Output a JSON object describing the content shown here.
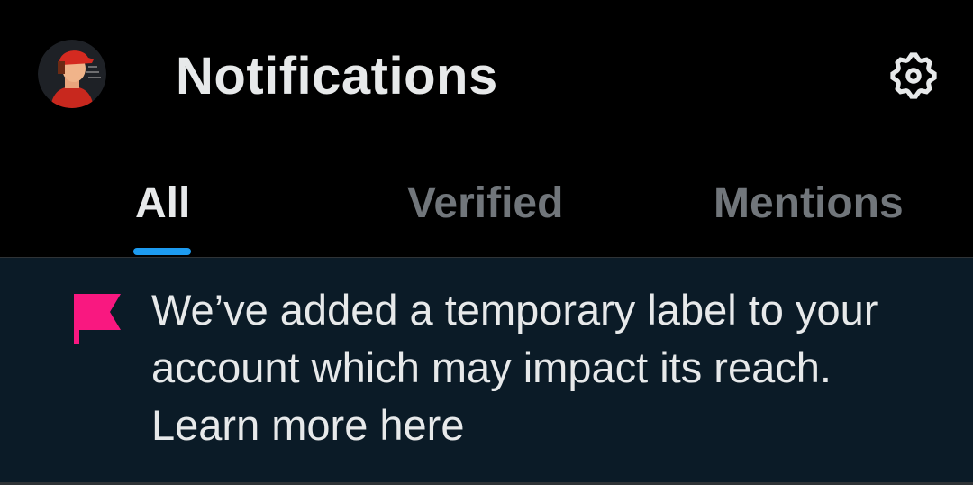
{
  "header": {
    "title": "Notifications",
    "avatar_icon": "user-avatar",
    "settings_icon": "gear-icon"
  },
  "tabs": [
    {
      "label": "All",
      "active": true
    },
    {
      "label": "Verified",
      "active": false
    },
    {
      "label": "Mentions",
      "active": false
    }
  ],
  "notice": {
    "icon": "flag-icon",
    "line1": "We’ve added a temporary label to your",
    "line2": "account which may impact its reach.",
    "line3": "Learn more here"
  },
  "colors": {
    "background": "#000000",
    "accent": "#1d9bf0",
    "flag": "#f91880",
    "notice_background": "#0b1b27",
    "inactive_tab": "#71767b",
    "text": "#e7e9ea"
  }
}
